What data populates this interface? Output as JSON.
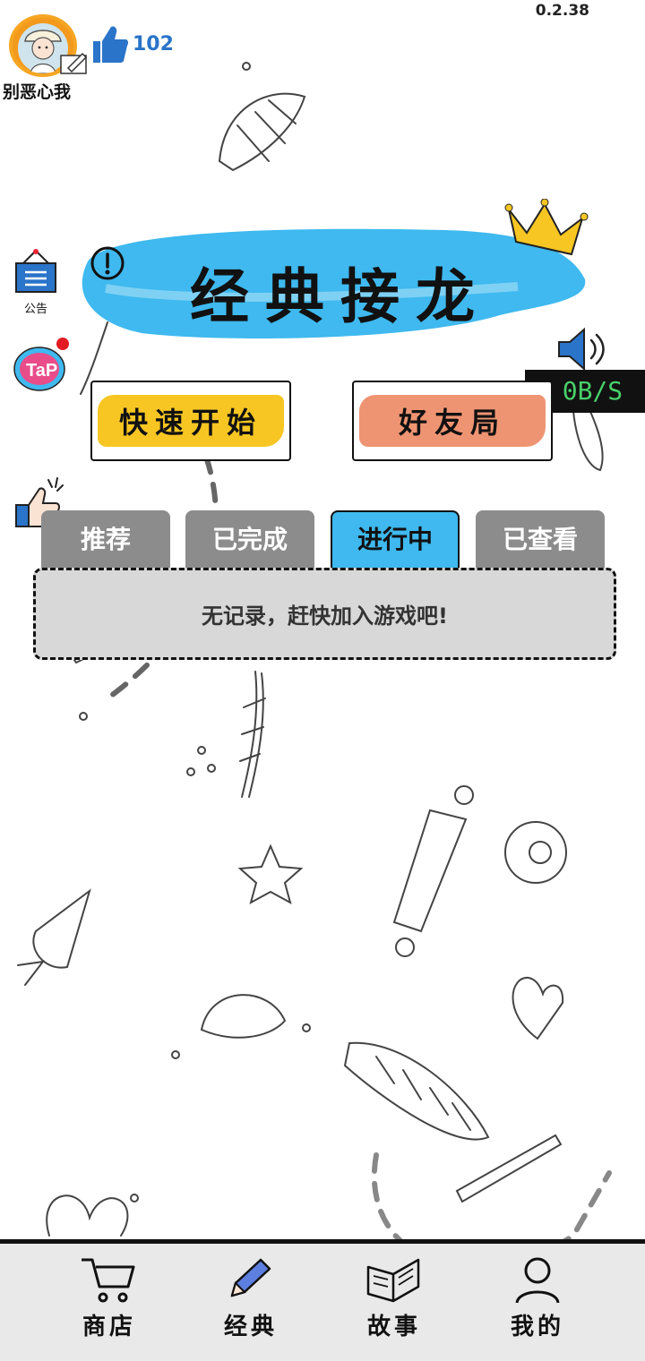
{
  "version": "0.2.38",
  "user": {
    "name": "别恶心我",
    "likes": "102"
  },
  "side_icons": {
    "notice_label": "公告",
    "tap_badge": "TaP"
  },
  "title": "经典接龙",
  "speed_indicator": "0B/S",
  "modes": {
    "quick_start": "快速开始",
    "friends_game": "好友局"
  },
  "tabs": [
    {
      "label": "推荐",
      "active": false
    },
    {
      "label": "已完成",
      "active": false
    },
    {
      "label": "进行中",
      "active": true
    },
    {
      "label": "已查看",
      "active": false
    }
  ],
  "empty_message": "无记录，赶快加入游戏吧!",
  "bottom_nav": [
    {
      "label": "商店",
      "icon": "cart-icon"
    },
    {
      "label": "经典",
      "icon": "pencil-icon"
    },
    {
      "label": "故事",
      "icon": "book-icon"
    },
    {
      "label": "我的",
      "icon": "person-icon"
    }
  ],
  "colors": {
    "title_brush": "#3fb9ef",
    "quick_start": "#f7c623",
    "friends_game": "#ef9472",
    "active_tab": "#3fb9ef",
    "inactive_tab": "#8c8c8c",
    "like_blue": "#2a74c9",
    "speed_green": "#49d06a"
  }
}
